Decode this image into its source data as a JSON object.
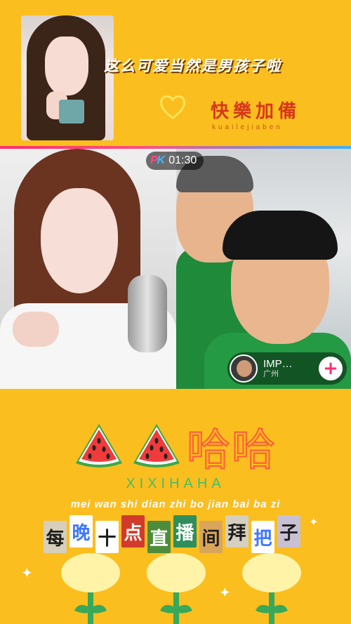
{
  "banner": {
    "title": "这么可爱当然是男孩子啦",
    "tag_cn": "快樂加備",
    "tag_pinyin": "kuailejiaben",
    "heart_icon": "heart-outline-icon"
  },
  "pk": {
    "badge_p": "P",
    "badge_k": "K",
    "timer": "01:30",
    "opponent": {
      "name": "IMP…",
      "city": "广州",
      "follow_icon": "plus-icon",
      "follow_label": "+"
    }
  },
  "branding": {
    "haha": "哈哈",
    "xixi": "XIXIHAHA",
    "pinyin": "mei wan shi dian zhi bo jian bai ba zi",
    "chars": [
      {
        "text": "每",
        "bg": "#d7cfbc",
        "fg": "#1d1d1d"
      },
      {
        "text": "晚",
        "bg": "#ffffff",
        "fg": "#3d77ff"
      },
      {
        "text": "十",
        "bg": "#ffffff",
        "fg": "#1d1d1d"
      },
      {
        "text": "点",
        "bg": "#d23a2a",
        "fg": "#ffffff"
      },
      {
        "text": "直",
        "bg": "#4d8c3b",
        "fg": "#ffffff"
      },
      {
        "text": "播",
        "bg": "#2f8e5b",
        "fg": "#ffffff"
      },
      {
        "text": "间",
        "bg": "#d9a55b",
        "fg": "#1d1d1d"
      },
      {
        "text": "拜",
        "bg": "#d6cfc0",
        "fg": "#1d1d1d"
      },
      {
        "text": "把",
        "bg": "#ffffff",
        "fg": "#3d77ff"
      },
      {
        "text": "子",
        "bg": "#c8c1d4",
        "fg": "#1d1d1d"
      }
    ]
  },
  "colors": {
    "background": "#FBBE1F",
    "accent_pink": "#ff2e6a",
    "accent_blue": "#37b2ff",
    "watermelon_red": "#ef3b3b",
    "watermelon_green": "#3aa84a"
  }
}
